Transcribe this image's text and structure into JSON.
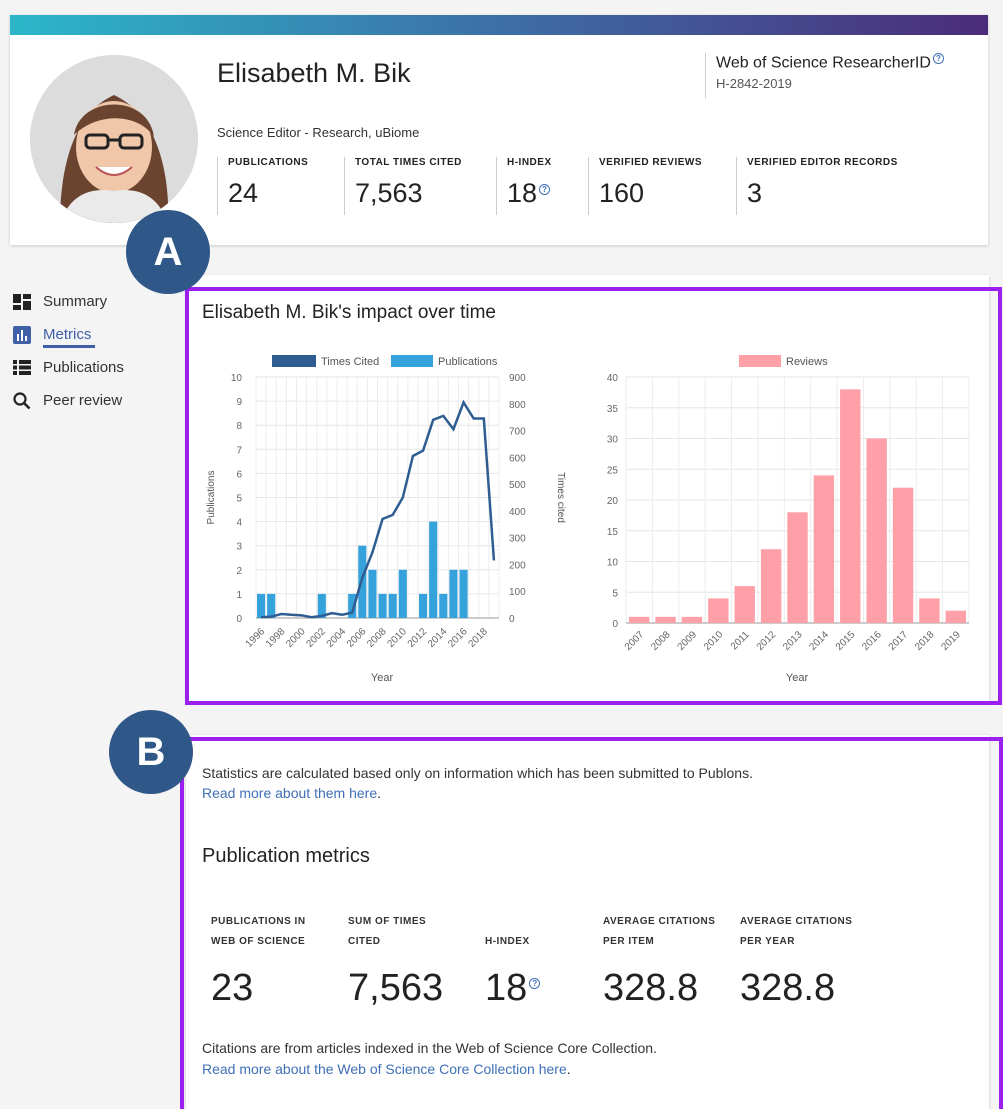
{
  "profile": {
    "name": "Elisabeth M. Bik",
    "affiliation": "Science Editor - Research, uBiome",
    "researcher_id_label": "Web of Science ResearcherID",
    "researcher_id": "H-2842-2019",
    "help_glyph": "?",
    "stats": [
      {
        "label": "PUBLICATIONS",
        "value": "24"
      },
      {
        "label": "TOTAL TIMES CITED",
        "value": "7,563"
      },
      {
        "label": "H-INDEX",
        "value": "18"
      },
      {
        "label": "VERIFIED REVIEWS",
        "value": "160"
      },
      {
        "label": "VERIFIED EDITOR RECORDS",
        "value": "3"
      }
    ]
  },
  "nav": {
    "items": [
      {
        "label": "Summary",
        "icon": "dashboard-icon"
      },
      {
        "label": "Metrics",
        "icon": "bar-chart-icon",
        "active": true
      },
      {
        "label": "Publications",
        "icon": "list-icon"
      },
      {
        "label": "Peer review",
        "icon": "search-icon"
      }
    ]
  },
  "impact": {
    "title": "Elisabeth M. Bik's impact over time"
  },
  "annotations": {
    "a": "A",
    "b": "B",
    "color": "#9b1fee",
    "badge_color": "#2f5787"
  },
  "chart_data": [
    {
      "type": "bar",
      "legend": [
        "Times Cited",
        "Publications"
      ],
      "xlabel": "Year",
      "ylabel": "Publications",
      "y2label": "Times cited",
      "ylim": [
        0,
        10
      ],
      "y2lim": [
        0,
        900
      ],
      "x_tick_labels": [
        "1996",
        "1998",
        "2000",
        "2002",
        "2004",
        "2006",
        "2008",
        "2010",
        "2012",
        "2014",
        "2016",
        "2018"
      ],
      "categories": [
        1996,
        1997,
        1998,
        1999,
        2000,
        2001,
        2002,
        2003,
        2004,
        2005,
        2006,
        2007,
        2008,
        2009,
        2010,
        2011,
        2012,
        2013,
        2014,
        2015,
        2016,
        2017,
        2018,
        2019
      ],
      "series": [
        {
          "name": "Publications",
          "kind": "bar",
          "color": "#36a2dc",
          "values": [
            1,
            1,
            0,
            0,
            0,
            0,
            1,
            0,
            0,
            1,
            3,
            2,
            1,
            1,
            2,
            0,
            1,
            4,
            1,
            2,
            2,
            0,
            0,
            0
          ]
        },
        {
          "name": "Times Cited",
          "kind": "line",
          "axis": "right",
          "color": "#2f5d91",
          "values": [
            3,
            5,
            15,
            12,
            10,
            3,
            8,
            18,
            12,
            20,
            150,
            245,
            370,
            385,
            450,
            605,
            625,
            740,
            755,
            705,
            805,
            745,
            745,
            215
          ]
        }
      ]
    },
    {
      "type": "bar",
      "legend": [
        "Reviews"
      ],
      "xlabel": "Year",
      "ylim": [
        0,
        40
      ],
      "categories": [
        "2007",
        "2008",
        "2009",
        "2010",
        "2011",
        "2012",
        "2013",
        "2014",
        "2015",
        "2016",
        "2017",
        "2018",
        "2019"
      ],
      "series": [
        {
          "name": "Reviews",
          "color": "#ff9fa8",
          "values": [
            1,
            1,
            1,
            4,
            6,
            12,
            18,
            24,
            38,
            30,
            22,
            4,
            2
          ]
        }
      ]
    }
  ],
  "metrics": {
    "note": "Statistics are calculated based only on information which has been submitted to Publons.",
    "note_link": "Read more about them here",
    "note_link_suffix": ".",
    "title": "Publication metrics",
    "items": [
      {
        "label_lines": [
          "PUBLICATIONS IN",
          "WEB OF SCIENCE"
        ],
        "value": "23"
      },
      {
        "label_lines": [
          "SUM OF TIMES",
          "CITED"
        ],
        "value": "7,563"
      },
      {
        "label_lines": [
          "",
          "H-INDEX"
        ],
        "value": "18"
      },
      {
        "label_lines": [
          "AVERAGE CITATIONS",
          "PER ITEM"
        ],
        "value": "328.8"
      },
      {
        "label_lines": [
          "AVERAGE CITATIONS",
          "PER YEAR"
        ],
        "value": "328.8"
      }
    ],
    "cite_note": "Citations are from articles indexed in the Web of Science Core Collection.",
    "cite_link": "Read more about the Web of Science Core Collection here",
    "cite_link_suffix": "."
  }
}
